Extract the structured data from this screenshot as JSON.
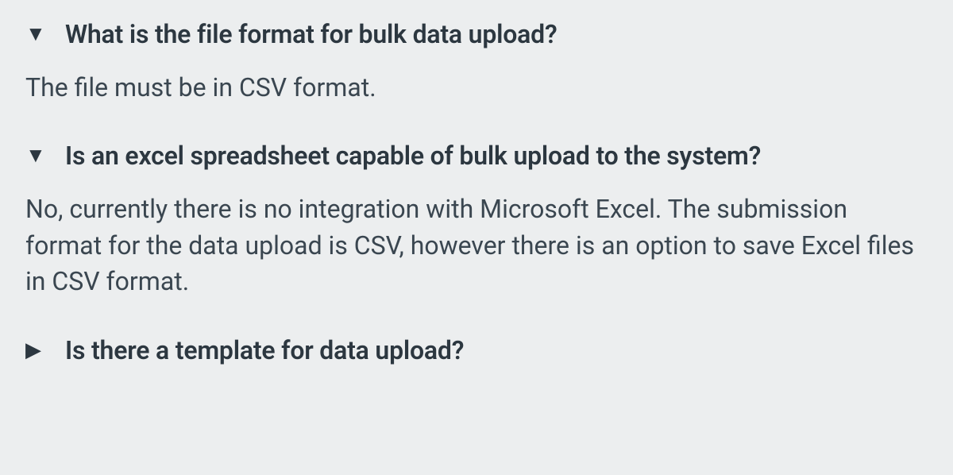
{
  "faq": [
    {
      "question": "What is the file format for bulk data upload?",
      "answer": "The file must be in CSV format.",
      "expanded": true
    },
    {
      "question": "Is an excel spreadsheet capable of bulk upload to the system?",
      "answer": "No, currently there is no integration with Microsoft Excel. The submission format for the data upload is CSV, however there is an option to save Excel files in CSV format.",
      "expanded": true
    },
    {
      "question": "Is there a template for data upload?",
      "answer": "",
      "expanded": false
    }
  ]
}
